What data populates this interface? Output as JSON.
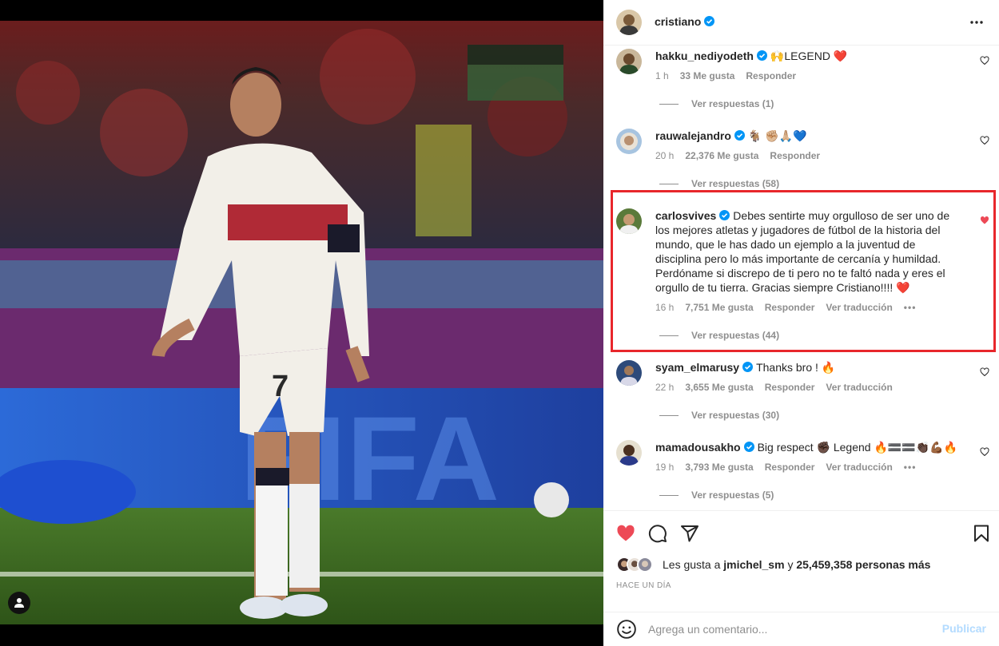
{
  "post": {
    "author": "cristiano",
    "author_verified": true
  },
  "comments": [
    {
      "username": "hakku_nediyodeth",
      "text": "🙌LEGEND ❤️",
      "time": "1 h",
      "likes": "33 Me gusta",
      "reply": "Responder",
      "translate": "",
      "view_replies": "Ver respuestas (1)",
      "liked": false
    },
    {
      "username": "rauwalejandro",
      "text": "🐐 ✊🏼🙏🏼💙",
      "time": "20 h",
      "likes": "22,376 Me gusta",
      "reply": "Responder",
      "translate": "",
      "view_replies": "Ver respuestas (58)",
      "liked": false
    },
    {
      "username": "carlosvives",
      "text": "Debes sentirte muy orgulloso de ser uno de los mejores atletas y jugadores de fútbol de la historia del mundo, que le has dado un ejemplo a la juventud de disciplina pero lo más importante de cercanía y humildad. Perdóname si discrepo de ti pero no te faltó nada y eres el orgullo de tu tierra. Gracias siempre Cristiano!!!! ❤️",
      "time": "16 h",
      "likes": "7,751 Me gusta",
      "reply": "Responder",
      "translate": "Ver traducción",
      "more": "•••",
      "view_replies": "Ver respuestas (44)",
      "liked": true,
      "highlighted": true
    },
    {
      "username": "syam_elmarusy",
      "text": "Thanks bro ! 🔥",
      "time": "22 h",
      "likes": "3,655 Me gusta",
      "reply": "Responder",
      "translate": "Ver traducción",
      "view_replies": "Ver respuestas (30)",
      "liked": false
    },
    {
      "username": "mamadousakho",
      "text": "Big respect ✊🏿 Legend 🔥🟰🟰👏🏿💪🏾🔥",
      "time": "19 h",
      "likes": "3,793 Me gusta",
      "reply": "Responder",
      "translate": "Ver traducción",
      "more": "•••",
      "view_replies": "Ver respuestas (5)",
      "liked": false
    }
  ],
  "actions": {
    "liked": true,
    "likes_prefix": "Les gusta a",
    "likes_user": "jmichel_sm",
    "likes_and": "y",
    "likes_others": "25,459,358 personas más",
    "time_ago": "HACE UN DÍA"
  },
  "add_comment": {
    "placeholder": "Agrega un comentario...",
    "publish_label": "Publicar"
  },
  "colors": {
    "like_red": "#ed4956",
    "highlight_red": "#e8262b",
    "verified_blue": "#0095f6",
    "publish_disabled": "#b3dbff"
  }
}
